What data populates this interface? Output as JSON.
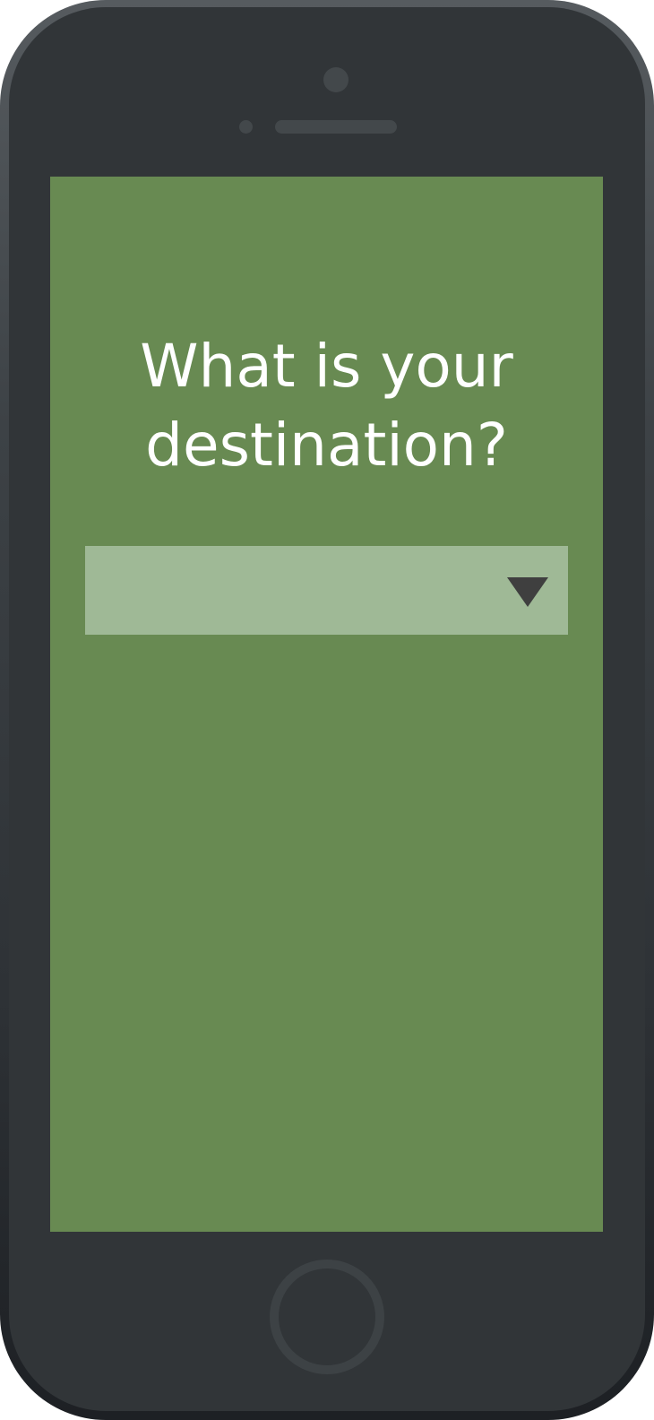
{
  "screen": {
    "background_color": "#688a52",
    "question": "What is your destination?"
  },
  "destination_select": {
    "selected_value": "",
    "background_color": "#9fb996",
    "icon": "chevron-down-icon"
  },
  "device": {
    "frame_color": "#313538",
    "home_button_icon": "home-button"
  }
}
